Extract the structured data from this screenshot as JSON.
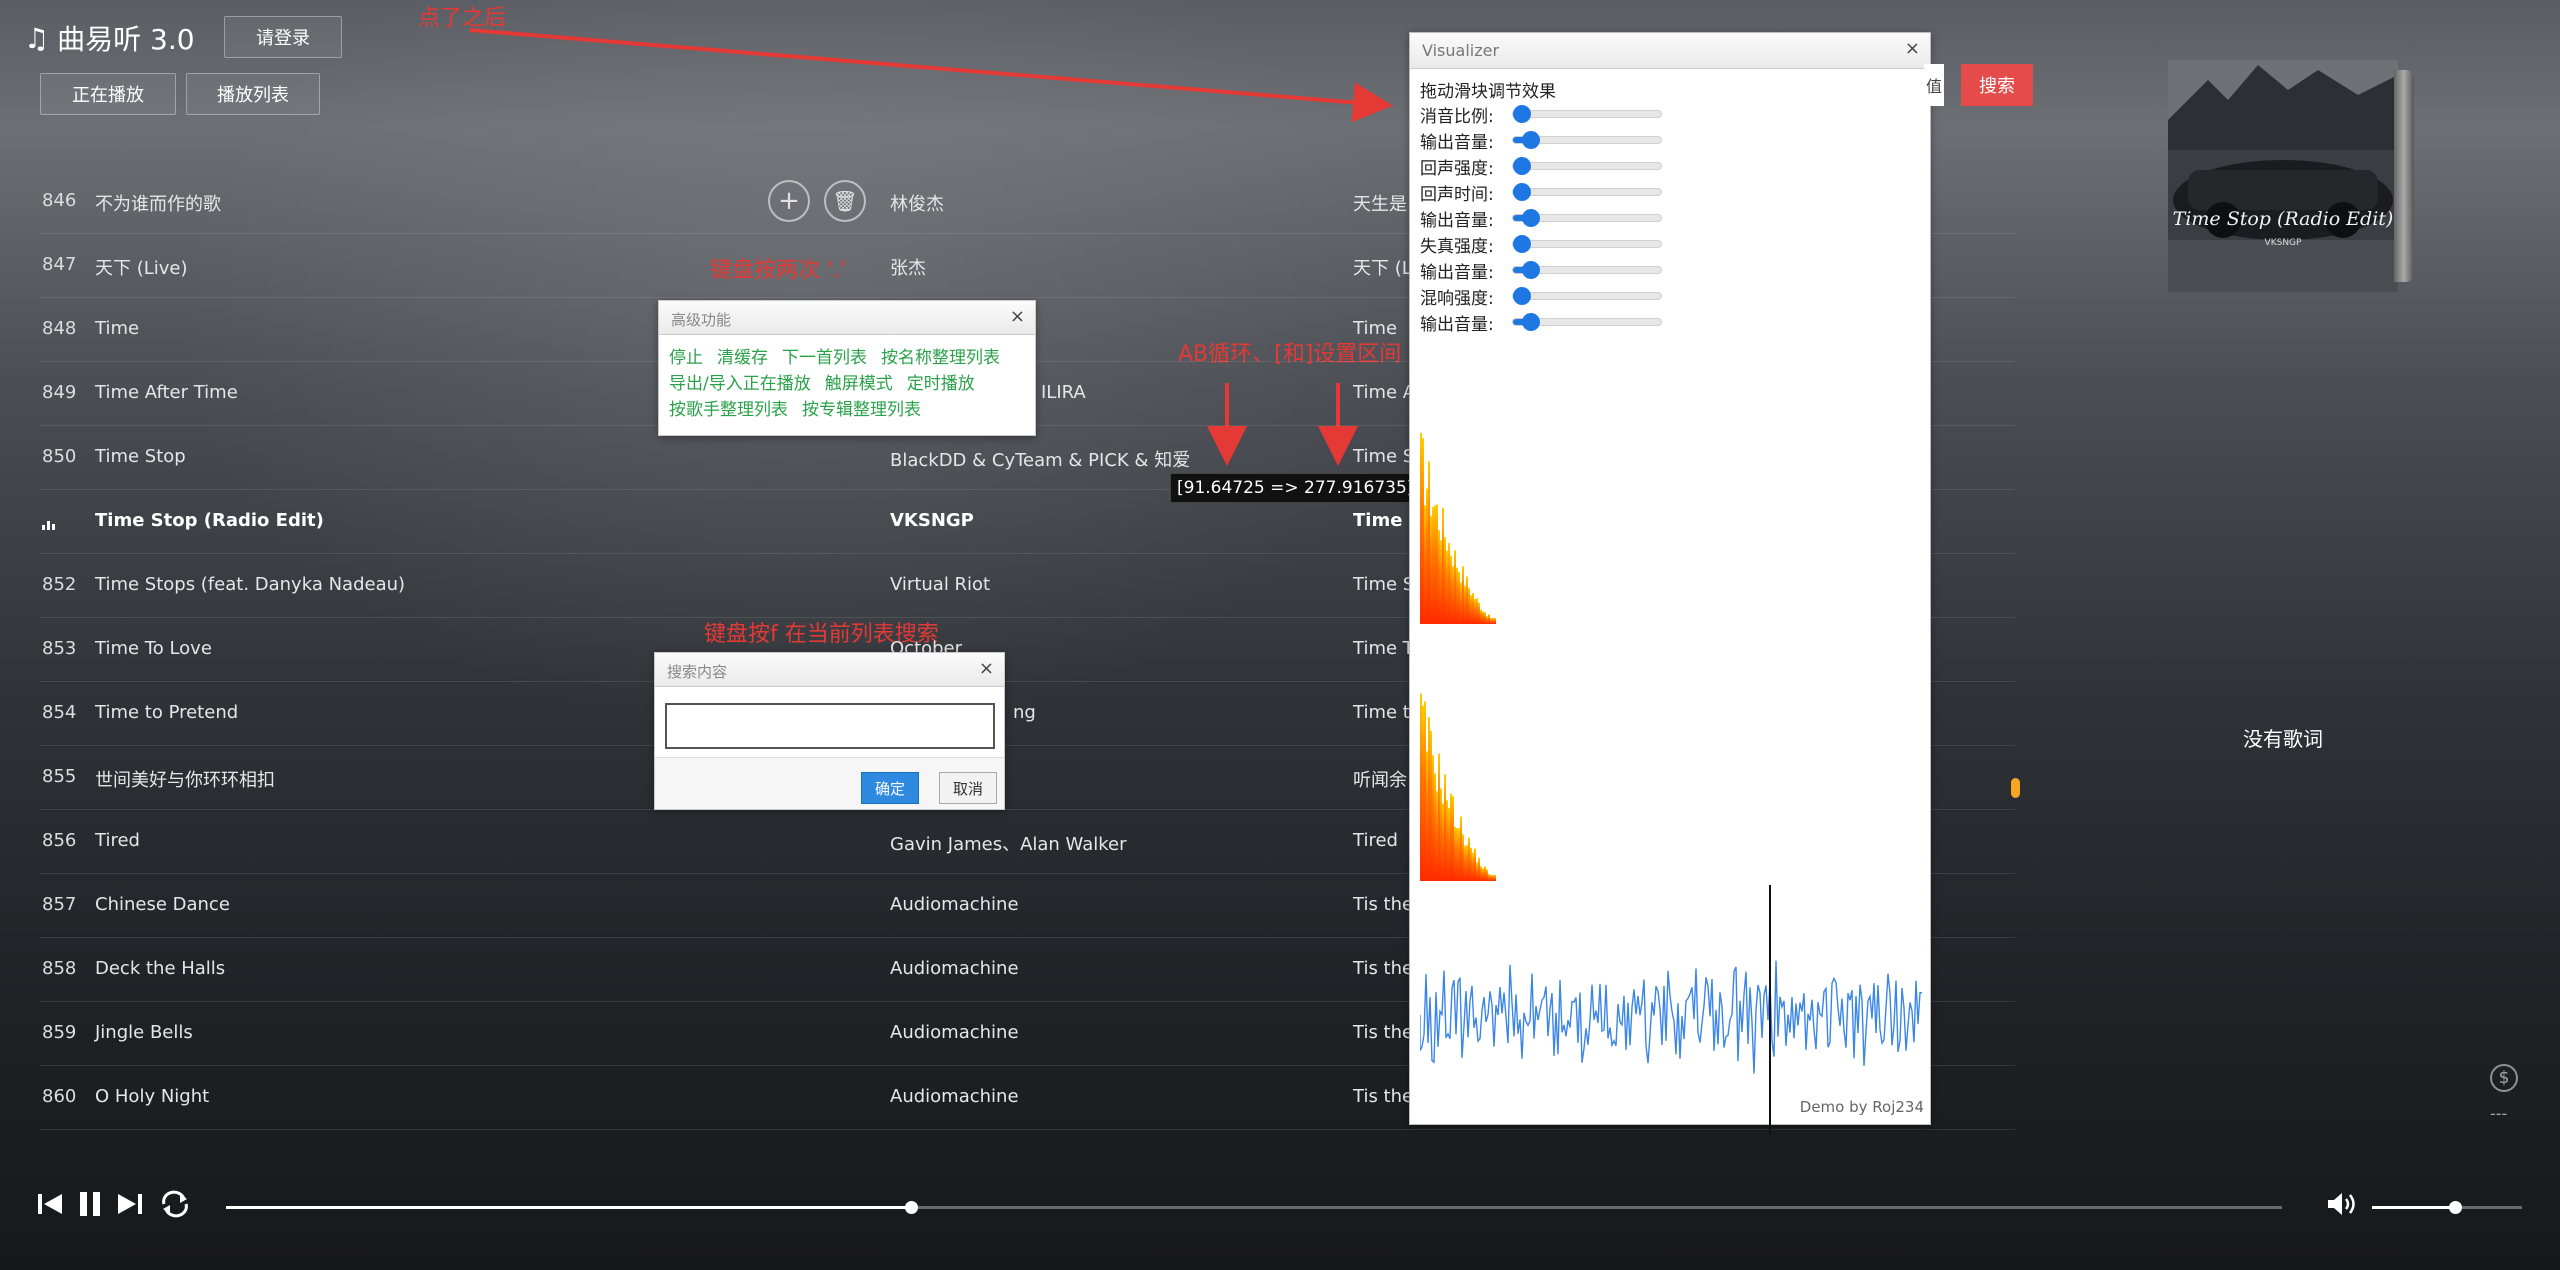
{
  "header": {
    "app_title": "曲易听 3.0",
    "login_label": "请登录",
    "now_playing_label": "正在播放",
    "playlist_label": "播放列表"
  },
  "annotations": {
    "after_click": "点了之后",
    "keyboard_dots": "键盘按两次 '.'",
    "ab_loop": "AB循环、[和]设置区间",
    "keyboard_f": "键盘按f 在当前列表搜索"
  },
  "songs": [
    {
      "num": "846",
      "title": "不为谁而作的歌",
      "artist": "林俊杰",
      "album": "天生是"
    },
    {
      "num": "847",
      "title": "天下 (Live)",
      "artist": "张杰",
      "album": "天下 (L"
    },
    {
      "num": "848",
      "title": "Time",
      "artist": "",
      "album": "Time"
    },
    {
      "num": "849",
      "title": "Time After Time",
      "artist": "ILIRA",
      "album": "Time A"
    },
    {
      "num": "850",
      "title": "Time Stop",
      "artist": "BlackDD & CyTeam & PICK & 知爱",
      "album": "Time S"
    },
    {
      "num": "",
      "title": "Time Stop (Radio Edit)",
      "artist": "VKSNGP",
      "album": "Time S"
    },
    {
      "num": "852",
      "title": "Time Stops (feat. Danyka Nadeau)",
      "artist": "Virtual Riot",
      "album": "Time S"
    },
    {
      "num": "853",
      "title": "Time To Love",
      "artist": "October",
      "album": "Time To"
    },
    {
      "num": "854",
      "title": "Time to Pretend",
      "artist": "ng",
      "album": "Time to"
    },
    {
      "num": "855",
      "title": "世间美好与你环环相扣",
      "artist": "",
      "album": "听闻余"
    },
    {
      "num": "856",
      "title": "Tired",
      "artist": "Gavin James、Alan Walker",
      "album": "Tired"
    },
    {
      "num": "857",
      "title": "Chinese Dance",
      "artist": "Audiomachine",
      "album": "Tis the"
    },
    {
      "num": "858",
      "title": "Deck the Halls",
      "artist": "Audiomachine",
      "album": "Tis the"
    },
    {
      "num": "859",
      "title": "Jingle Bells",
      "artist": "Audiomachine",
      "album": "Tis the"
    },
    {
      "num": "860",
      "title": "O Holy Night",
      "artist": "Audiomachine",
      "album": "Tis the"
    }
  ],
  "advanced": {
    "title": "高级功能",
    "close": "×",
    "links": [
      "停止",
      "清缓存",
      "下一首列表",
      "按名称整理列表",
      "导出/导入正在播放",
      "触屏模式",
      "定时播放",
      "按歌手整理列表",
      "按专辑整理列表"
    ]
  },
  "search_dialog": {
    "title": "搜索内容",
    "close": "×",
    "ok": "确定",
    "cancel": "取消"
  },
  "tooltip": "[91.64725 => 277.916735]",
  "visualizer": {
    "title": "Visualizer",
    "close": "×",
    "hint": "拖动滑块调节效果",
    "sliders": [
      {
        "label": "消音比例:",
        "value": 0.0
      },
      {
        "label": "输出音量:",
        "value": 0.12
      },
      {
        "label": "回声强度:",
        "value": 0.0
      },
      {
        "label": "回声时间:",
        "value": 0.0
      },
      {
        "label": "输出音量:",
        "value": 0.12
      },
      {
        "label": "失真强度:",
        "value": 0.0
      },
      {
        "label": "输出音量:",
        "value": 0.12
      },
      {
        "label": "混响强度:",
        "value": 0.0
      },
      {
        "label": "输出音量:",
        "value": 0.12
      }
    ],
    "credit": "Demo by Roj234"
  },
  "right_panel": {
    "search_tail": "值",
    "search_button": "搜索",
    "album_text": "Time Stop (Radio Edit)",
    "album_sub": "VKSNGP",
    "no_lyrics": "没有歌词",
    "dash": "---"
  },
  "player": {
    "progress": 0.333,
    "volume": 0.55
  },
  "colors": {
    "accent_red": "#e54b4b",
    "annotation_red": "#e53935",
    "link_green": "#2aa24a",
    "slider_blue": "#1e78e4"
  }
}
